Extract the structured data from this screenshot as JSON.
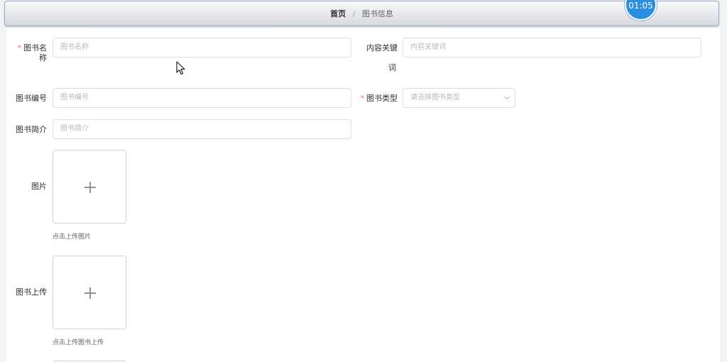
{
  "breadcrumb": {
    "home": "首页",
    "separator": "/",
    "current": "图书信息"
  },
  "timer": "01:05",
  "form": {
    "book_name": {
      "label": "图书名称",
      "required": "*",
      "placeholder": "图书名称"
    },
    "keyword": {
      "label_line1": "内容关键",
      "label_line2": "词",
      "placeholder": "内容关键词"
    },
    "book_number": {
      "label": "图书编号",
      "placeholder": "图书编号"
    },
    "book_type": {
      "label": "图书类型",
      "required": "*",
      "placeholder": "请选择图书类型"
    },
    "book_intro": {
      "label": "图书简介",
      "placeholder": "图书简介"
    },
    "image": {
      "label": "图片",
      "hint": "点击上传图片"
    },
    "book_upload": {
      "label": "图书上传",
      "hint": "点击上传图书上传"
    }
  },
  "icons": {
    "upload": "plus-icon",
    "select": "chevron-down-icon",
    "pointer": "cursor-icon"
  }
}
